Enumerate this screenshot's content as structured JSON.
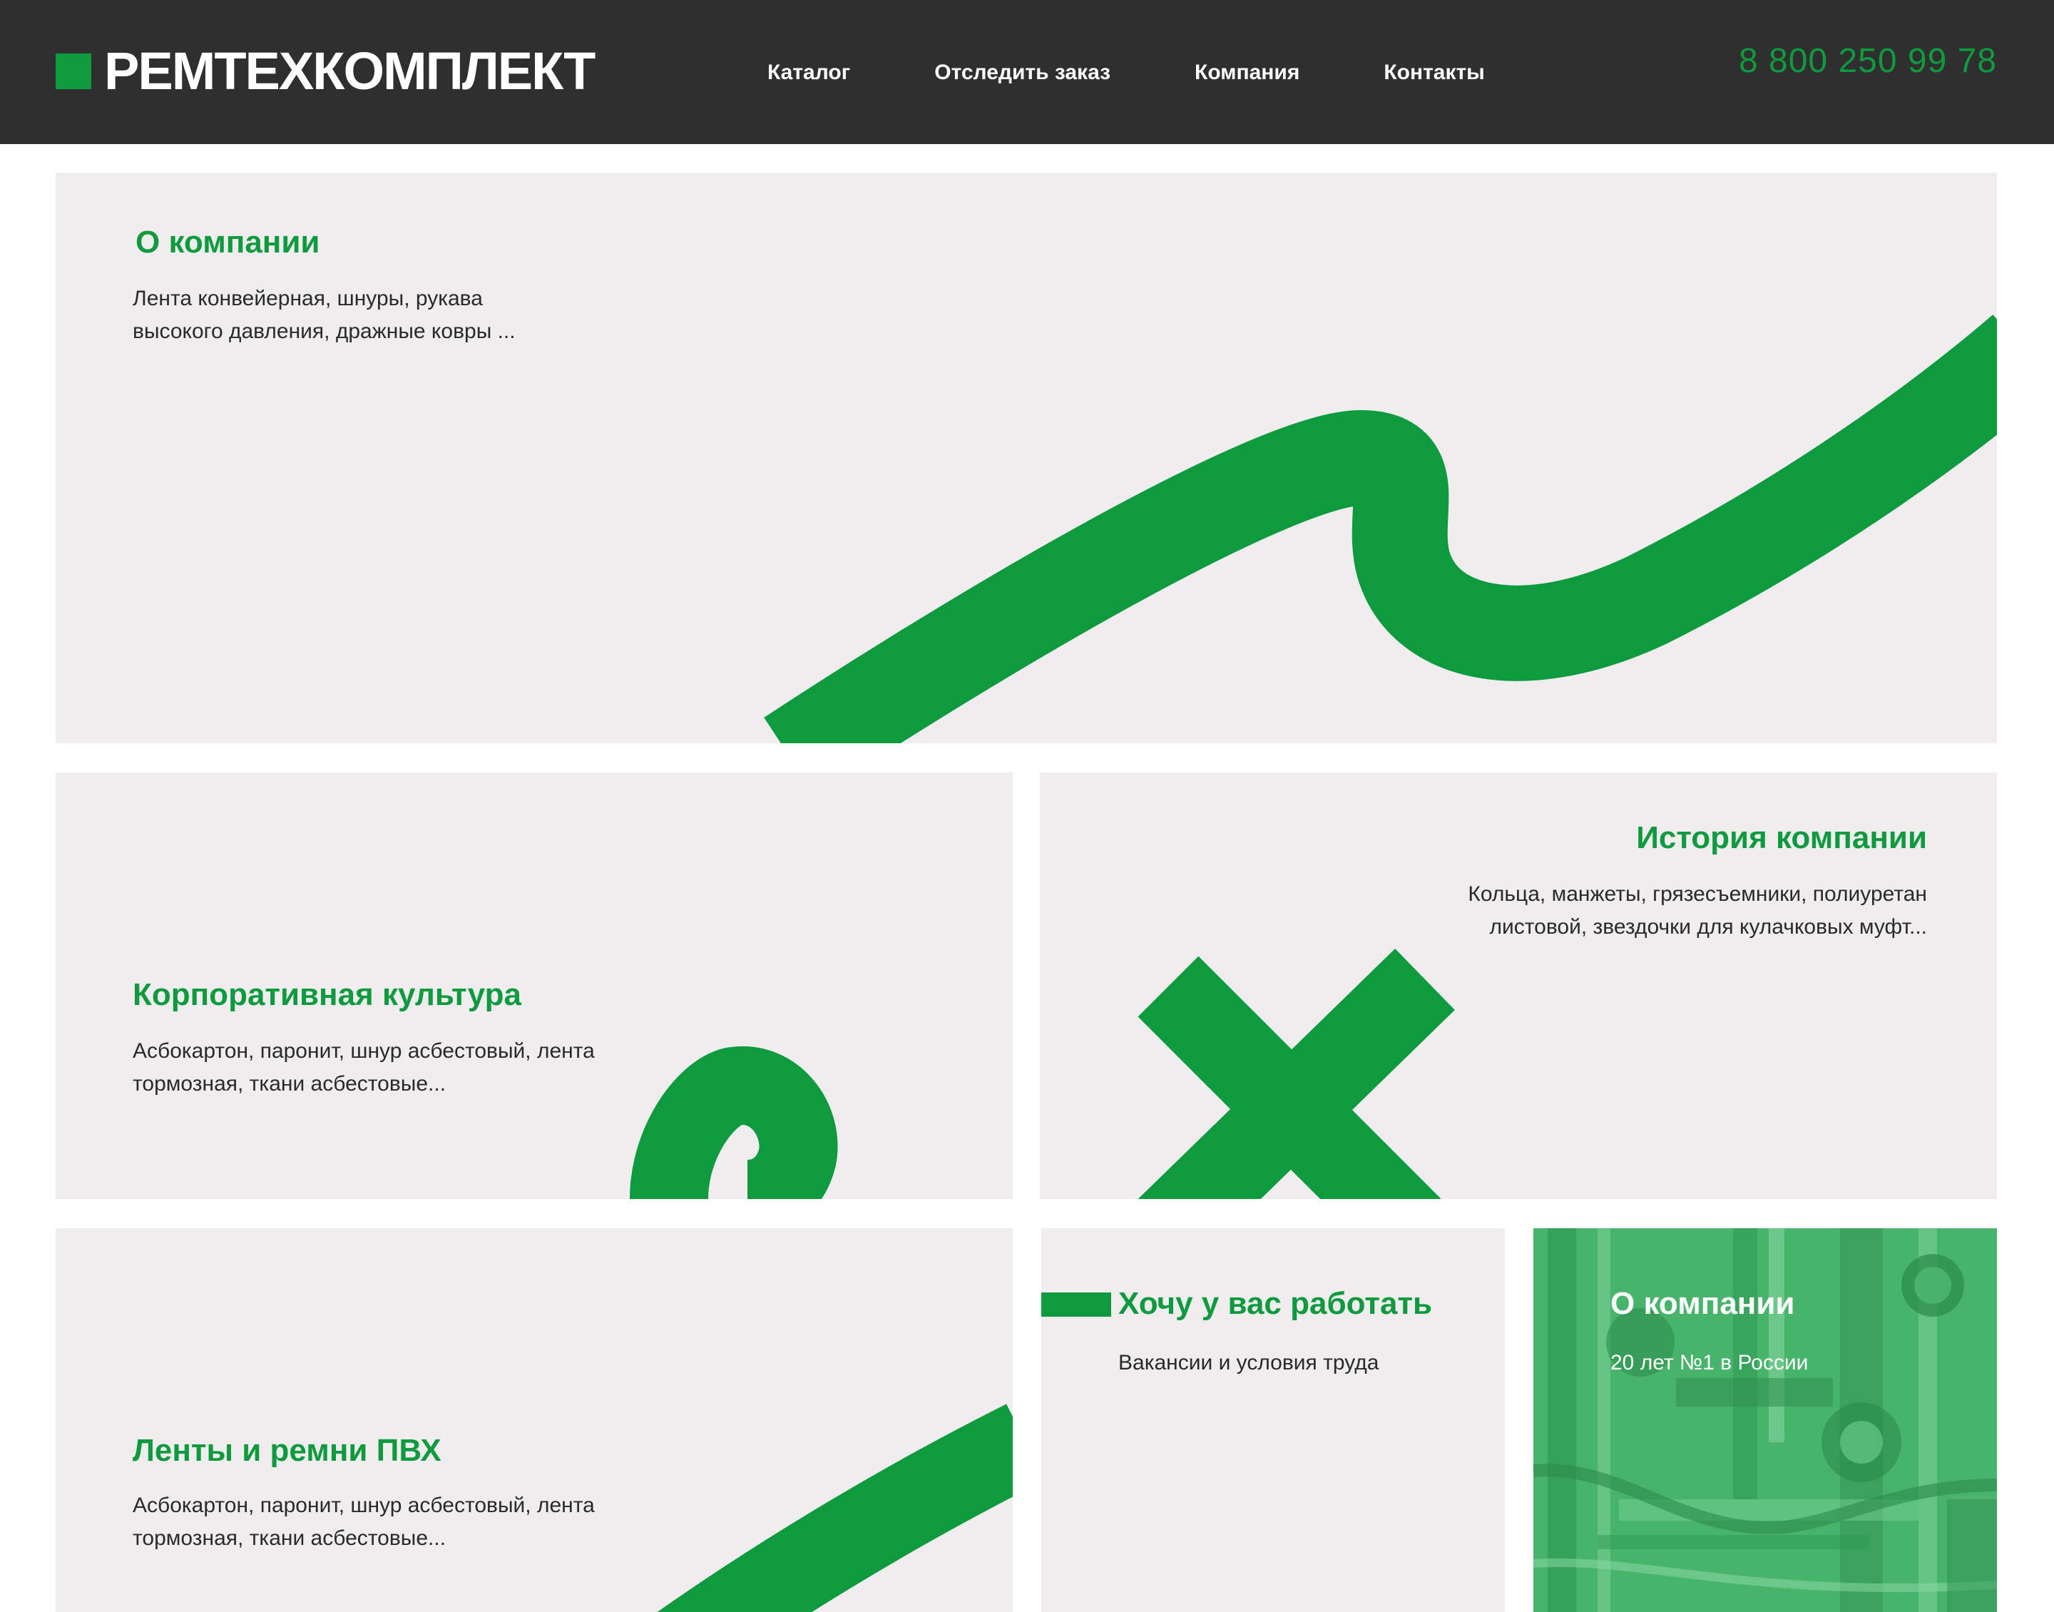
{
  "header": {
    "logo_text": "РЕМТЕХКОМПЛЕКТ",
    "nav": [
      "Каталог",
      "Отследить заказ",
      "Компания",
      "Контакты"
    ],
    "phone": "8 800 250 99 78"
  },
  "cards": {
    "about": {
      "title": "О компании",
      "text": [
        "Лента конвейерная, шнуры, рукава",
        "высокого давления, дражные ковры ..."
      ]
    },
    "culture": {
      "title": "Корпоративная культура",
      "text": [
        "Асбокартон, паронит, шнур асбестовый, лента",
        "тормозная, ткани асбестовые..."
      ]
    },
    "history": {
      "title": "История компании",
      "text": [
        "Кольца, манжеты, грязесъемники, полиуретан",
        "листовой, звездочки для кулачковых муфт..."
      ]
    },
    "belts": {
      "title": "Ленты и ремни ПВХ",
      "text": [
        "Асбокартон, паронит, шнур асбестовый, лента",
        "тормозная, ткани асбестовые..."
      ]
    },
    "jobs": {
      "title": "Хочу у вас работать",
      "text": "Вакансии и условия труда"
    },
    "photo": {
      "title": "О компании",
      "text": "20 лет №1 в России"
    }
  },
  "colors": {
    "accent": "#0f9a3f",
    "header_bg": "#2f2f2f",
    "card_bg": "#efeded",
    "photo_tint": "#3fae63"
  }
}
